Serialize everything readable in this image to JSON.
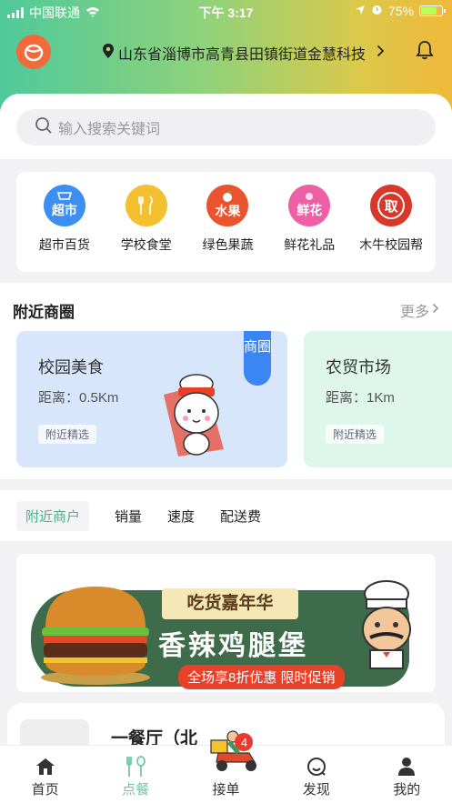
{
  "status_bar": {
    "carrier": "中国联通",
    "time": "下午 3:17",
    "battery": "75%"
  },
  "header": {
    "logo_icon": "app-logo-icon",
    "location": "山东省淄博市高青县田镇街道金慧科技",
    "bell_icon": "bell-icon"
  },
  "search": {
    "placeholder": "输入搜索关键词"
  },
  "categories": [
    {
      "icon_text": "超市",
      "label": "超市百货",
      "color": "#3c8ef0"
    },
    {
      "icon_text": "",
      "label": "学校食堂",
      "color": "#f5c030"
    },
    {
      "icon_text": "水果",
      "label": "绿色果蔬",
      "color": "#e9542e"
    },
    {
      "icon_text": "鲜花",
      "label": "鲜花礼品",
      "color": "#ee5fa6"
    },
    {
      "icon_text": "取",
      "label": "木牛校园帮",
      "color": "#d9372a"
    }
  ],
  "nearby": {
    "title": "附近商圈",
    "more": "更多",
    "cards": [
      {
        "name": "校园美食",
        "distance": "距离：0.5Km",
        "tag": "附近精选",
        "ribbon": "商圈"
      },
      {
        "name": "农贸市场",
        "distance": "距离：1Km",
        "tag": "附近精选"
      }
    ]
  },
  "tabs": [
    "附近商户",
    "销量",
    "速度",
    "配送费"
  ],
  "banner": {
    "title": "吃货嘉年华",
    "main": "香辣鸡腿堡",
    "sub": "全场享8折优惠 限时促销"
  },
  "shop": {
    "name": "一餐厅（北"
  },
  "bottom_nav": [
    {
      "label": "首页",
      "icon": "home-icon"
    },
    {
      "label": "点餐",
      "icon": "utensils-icon"
    },
    {
      "label": "接单",
      "icon": "delivery-scooter-icon",
      "badge": "4"
    },
    {
      "label": "发现",
      "icon": "discover-icon"
    },
    {
      "label": "我的",
      "icon": "user-icon"
    }
  ],
  "colors": {
    "accent": "#4fb08c",
    "header_start": "#4fc99a",
    "header_end": "#f0b83a"
  }
}
